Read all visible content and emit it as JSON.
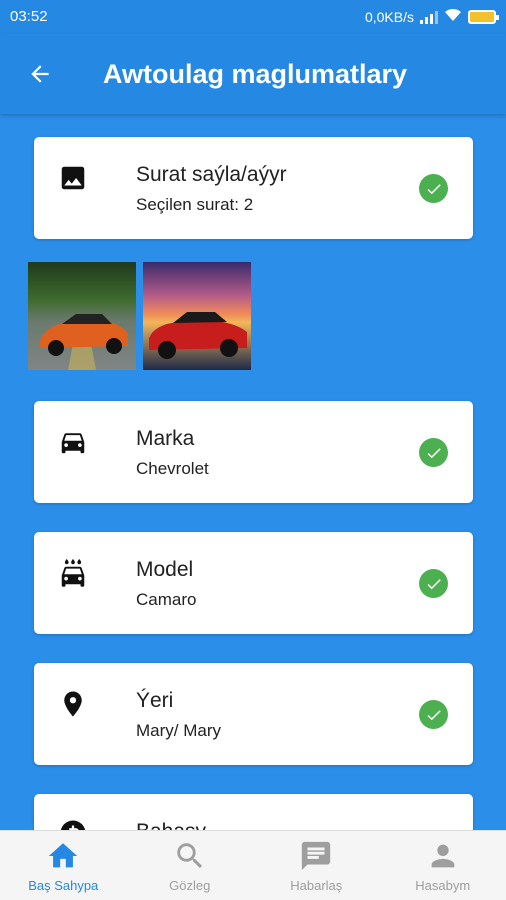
{
  "status_bar": {
    "time": "03:52",
    "network_speed": "0,0KB/s"
  },
  "app_bar": {
    "title": "Awtoulag maglumatlary",
    "back_icon": "arrow-back-icon"
  },
  "cards": [
    {
      "title": "Surat saýla/aýyr",
      "subtitle": "Seçilen surat: 2",
      "icon": "image-icon",
      "checked": true
    },
    {
      "title": "Marka",
      "subtitle": "Chevrolet",
      "icon": "car-icon",
      "checked": true
    },
    {
      "title": "Model",
      "subtitle": "Camaro",
      "icon": "car-wash-icon",
      "checked": true
    },
    {
      "title": "Ýeri",
      "subtitle": "Mary/ Mary",
      "icon": "location-pin-icon",
      "checked": true
    },
    {
      "title": "Bahasy",
      "icon": "price-icon"
    }
  ],
  "photos": [
    {
      "description": "orange car on road",
      "icon": "car-photo"
    },
    {
      "description": "red car at sunset",
      "icon": "car-photo"
    }
  ],
  "bottom_nav": [
    {
      "label": "Baş Sahypa",
      "icon": "home-icon",
      "active": true
    },
    {
      "label": "Gözleg",
      "icon": "search-icon",
      "active": false
    },
    {
      "label": "Habarlaş",
      "icon": "chat-icon",
      "active": false
    },
    {
      "label": "Hasabym",
      "icon": "person-icon",
      "active": false
    }
  ],
  "colors": {
    "primary": "#2588e3",
    "check": "#4caf50",
    "nav_inactive": "#9e9e9e"
  }
}
